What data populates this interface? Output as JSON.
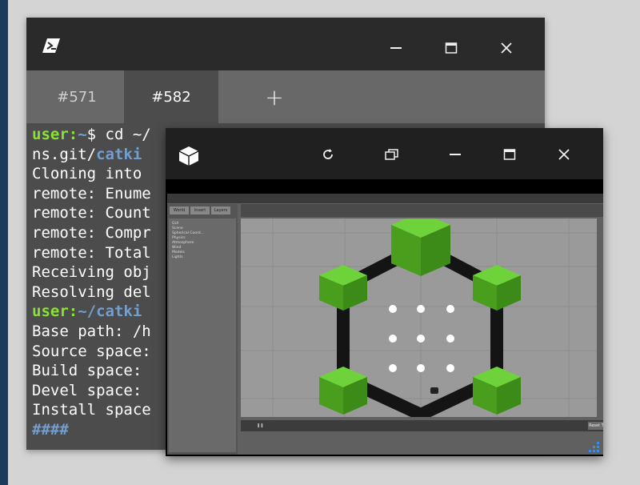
{
  "terminal": {
    "tabs": [
      {
        "label": "#571",
        "active": false
      },
      {
        "label": "#582",
        "active": true
      }
    ],
    "add_tab": "+",
    "lines": [
      [
        {
          "t": "user:",
          "c": "u"
        },
        {
          "t": "~",
          "c": "p"
        },
        {
          "t": "$ cd ~/",
          "c": ""
        }
      ],
      [
        {
          "t": "ns.git/",
          "c": ""
        },
        {
          "t": "catki",
          "c": "p"
        }
      ],
      [
        {
          "t": "Cloning into ",
          "c": ""
        }
      ],
      [
        {
          "t": "remote: Enume",
          "c": ""
        }
      ],
      [
        {
          "t": "remote: Count",
          "c": ""
        }
      ],
      [
        {
          "t": "remote: Compr",
          "c": ""
        }
      ],
      [
        {
          "t": "remote: Total",
          "c": ""
        }
      ],
      [
        {
          "t": "Receiving obj",
          "c": ""
        }
      ],
      [
        {
          "t": "Resolving del",
          "c": ""
        }
      ],
      [
        {
          "t": "user:",
          "c": "u"
        },
        {
          "t": "~/catki",
          "c": "p"
        }
      ],
      [
        {
          "t": "Base path: /h",
          "c": ""
        }
      ],
      [
        {
          "t": "Source space:",
          "c": ""
        }
      ],
      [
        {
          "t": "Build space: ",
          "c": ""
        }
      ],
      [
        {
          "t": "Devel space: ",
          "c": ""
        }
      ],
      [
        {
          "t": "Install space",
          "c": ""
        }
      ],
      [
        {
          "t": "####",
          "c": "p"
        }
      ]
    ]
  },
  "viewer": {
    "tree_items": [
      "GUI",
      "Scene",
      "Spherical Coord...",
      "Physics",
      "Atmosphere",
      "Wind",
      "Models",
      "Lights"
    ],
    "gz_tabs": [
      "World",
      "Insert",
      "Layers"
    ],
    "bottom_button": "Reset Time",
    "colors": {
      "cube": "#5fb82a",
      "rod": "#141414",
      "floor": "#9a9a9a"
    }
  }
}
